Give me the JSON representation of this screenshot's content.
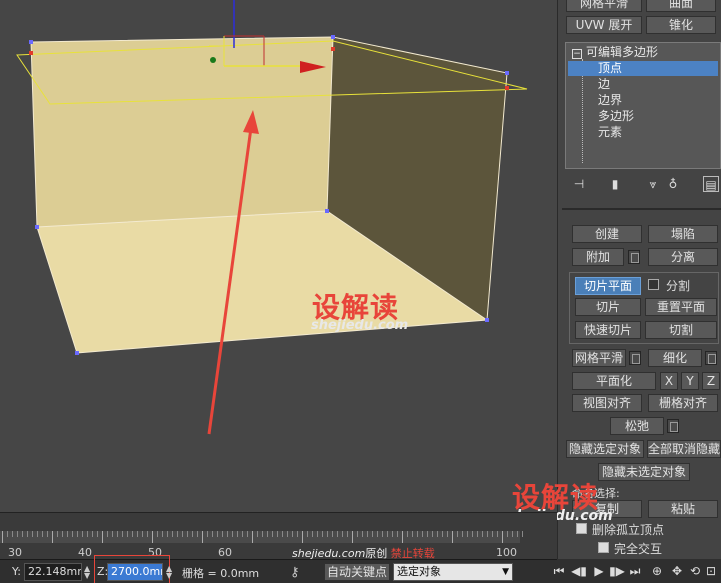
{
  "panel": {
    "top_buttons": {
      "shell_label": "网格平滑",
      "surface_label": "曲面",
      "uvw_label": "UVW 展开",
      "taper_label": "锥化"
    },
    "stack": {
      "root": "可编辑多边形",
      "items": [
        "顶点",
        "边",
        "边界",
        "多边形",
        "元素"
      ]
    },
    "edit_geometry": {
      "create": "创建",
      "collapse": "塌陷",
      "attach": "附加",
      "detach": "分离",
      "slice_plane": "切片平面",
      "split": "分割",
      "slice": "切片",
      "reset_plane": "重置平面",
      "quickslice": "快速切片",
      "cut": "切割",
      "meshsmooth": "网格平滑",
      "tessellate": "细化",
      "make_planar": "平面化",
      "x": "X",
      "y": "Y",
      "z": "Z",
      "view_align": "视图对齐",
      "grid_align": "栅格对齐",
      "relax": "松弛",
      "hide_selected": "隐藏选定对象",
      "unhide_all": "全部取消隐藏",
      "hide_unselected": "隐藏未选定对象",
      "copy": "复制",
      "paste": "粘贴",
      "named_sel_label": "命名选择:",
      "delete_isolated": "删除孤立顶点",
      "full_interact": "完全交互"
    }
  },
  "timeline": {
    "labels": [
      "30",
      "40",
      "50",
      "60",
      "100"
    ]
  },
  "status": {
    "y_label": "Y:",
    "y_value": "22.148mm",
    "z_label": "Z:",
    "z_value": "2700.0mm",
    "grid": "栅格 = 0.0mm",
    "autokey": "自动关键点",
    "selected": "选定对象"
  },
  "watermark": {
    "logo": "设解读",
    "site": "shejiedu.com",
    "footer_site": "shejiedu.com",
    "footer_original": "原创",
    "footer_noreprint": "禁止转载"
  },
  "colors": {
    "viewport_bg": "#464646",
    "box_face": "#e3d39a",
    "box_dark": "#5c553b",
    "accent_red": "#e8453a",
    "selection_blue": "#4c82c4"
  }
}
